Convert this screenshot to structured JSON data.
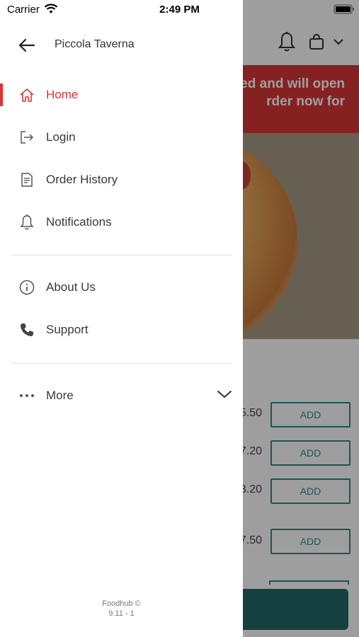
{
  "status_bar": {
    "carrier": "Carrier",
    "time": "2:49 PM"
  },
  "drawer": {
    "restaurant_name": "Piccola Taverna",
    "items": [
      {
        "label": "Home",
        "icon": "home-icon",
        "active": true
      },
      {
        "label": "Login",
        "icon": "login-icon",
        "active": false
      },
      {
        "label": "Order History",
        "icon": "receipt-icon",
        "active": false
      },
      {
        "label": "Notifications",
        "icon": "bell-icon",
        "active": false
      },
      {
        "label": "About Us",
        "icon": "info-icon",
        "active": false
      },
      {
        "label": "Support",
        "icon": "phone-icon",
        "active": false
      },
      {
        "label": "More",
        "icon": "more-dots-icon",
        "active": false
      }
    ],
    "footer": {
      "brand": "Foodhub ©",
      "version": "9.11 - 1"
    }
  },
  "background": {
    "banner_text": "ed and will open\nrder now for",
    "prices": [
      ".50",
      "7.20",
      "3.20",
      "7.50"
    ],
    "prices_prefix": [
      "5",
      "",
      "",
      ""
    ],
    "add_label": "ADD"
  },
  "colors": {
    "accent": "#d93636",
    "teal": "#2f8a8a",
    "teal_dark": "#1f6b68"
  }
}
